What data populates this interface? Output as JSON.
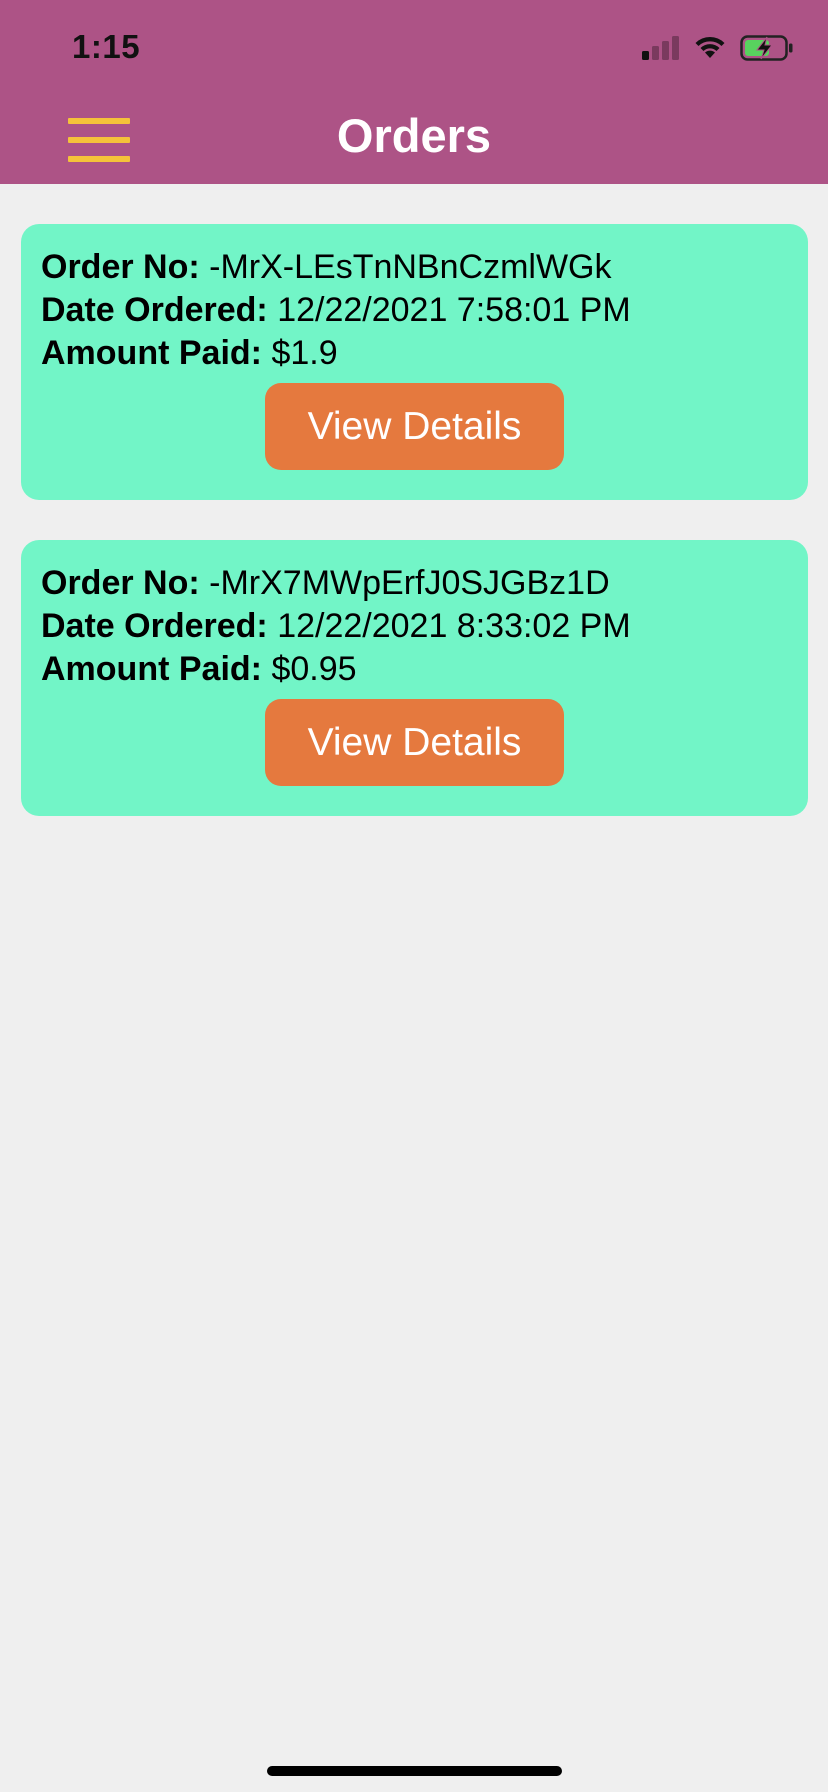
{
  "status_bar": {
    "time": "1:15",
    "icons": [
      "cellular-signal-icon",
      "wifi-icon",
      "battery-charging-icon"
    ]
  },
  "header": {
    "title": "Orders",
    "menu_icon": "hamburger-menu-icon"
  },
  "labels": {
    "order_no": "Order No:",
    "date_ordered": "Date Ordered:",
    "amount_paid": "Amount Paid:"
  },
  "orders": [
    {
      "order_no": "-MrX-LEsTnNBnCzmlWGk",
      "date_ordered": "12/22/2021 7:58:01 PM",
      "amount_paid": "$1.9",
      "button_label": "View Details"
    },
    {
      "order_no": "-MrX7MWpErfJ0SJGBz1D",
      "date_ordered": "12/22/2021 8:33:02 PM",
      "amount_paid": "$0.95",
      "button_label": "View Details"
    }
  ],
  "colors": {
    "header_bg": "#ad5386",
    "menu_icon": "#f5c23a",
    "page_bg": "#efefef",
    "card_bg": "#72f5c7",
    "button_bg": "#e5793e",
    "button_text": "#ffffff",
    "title_text": "#ffffff"
  }
}
